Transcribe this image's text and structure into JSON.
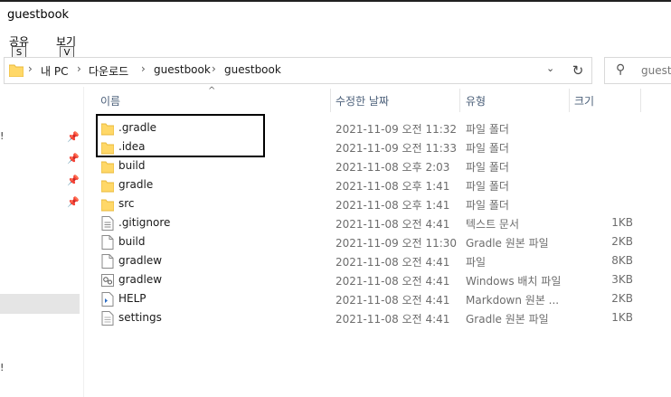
{
  "window": {
    "title": "guestbook"
  },
  "ribbon": {
    "tabs": [
      {
        "label": "공유",
        "keytip": "S"
      },
      {
        "label": "보기",
        "keytip": "V"
      }
    ]
  },
  "address": {
    "parts": [
      "내 PC",
      "다운로드",
      "guestbook",
      "guestbook"
    ],
    "separator": "›",
    "dropdown_glyph": "⌄",
    "refresh_glyph": "↻"
  },
  "search": {
    "placeholder": "guestbook 검색",
    "visible_text": "guestb"
  },
  "columns": {
    "name": "이름",
    "date": "수정한 날짜",
    "type": "유형",
    "size": "크기"
  },
  "navpane": {
    "pin_glyph": "📌",
    "fragment": "!"
  },
  "files": [
    {
      "name": ".gradle",
      "date": "2021-11-09 오전 11:32",
      "type": "파일 폴더",
      "size": "",
      "icon": "folder-icon"
    },
    {
      "name": ".idea",
      "date": "2021-11-09 오전 11:33",
      "type": "파일 폴더",
      "size": "",
      "icon": "folder-icon"
    },
    {
      "name": "build",
      "date": "2021-11-08 오후 2:03",
      "type": "파일 폴더",
      "size": "",
      "icon": "folder-icon"
    },
    {
      "name": "gradle",
      "date": "2021-11-08 오후 1:41",
      "type": "파일 폴더",
      "size": "",
      "icon": "folder-icon"
    },
    {
      "name": "src",
      "date": "2021-11-08 오후 1:41",
      "type": "파일 폴더",
      "size": "",
      "icon": "folder-icon"
    },
    {
      "name": ".gitignore",
      "date": "2021-11-08 오전 4:41",
      "type": "텍스트 문서",
      "size": "1KB",
      "icon": "text-file-icon"
    },
    {
      "name": "build",
      "date": "2021-11-09 오전 11:30",
      "type": "Gradle 원본 파일",
      "size": "2KB",
      "icon": "file-icon"
    },
    {
      "name": "gradlew",
      "date": "2021-11-08 오전 4:41",
      "type": "파일",
      "size": "8KB",
      "icon": "file-icon"
    },
    {
      "name": "gradlew",
      "date": "2021-11-08 오전 4:41",
      "type": "Windows 배치 파일",
      "size": "3KB",
      "icon": "batch-file-icon"
    },
    {
      "name": "HELP",
      "date": "2021-11-08 오전 4:41",
      "type": "Markdown 원본 ...",
      "size": "2KB",
      "icon": "markdown-file-icon"
    },
    {
      "name": "settings",
      "date": "2021-11-08 오전 4:41",
      "type": "Gradle 원본 파일",
      "size": "1KB",
      "icon": "file-icon"
    }
  ],
  "colors": {
    "folder": "#ffd868",
    "folder_dark": "#e8b93a",
    "header_text": "#4c607a",
    "highlight_border": "#000000"
  }
}
